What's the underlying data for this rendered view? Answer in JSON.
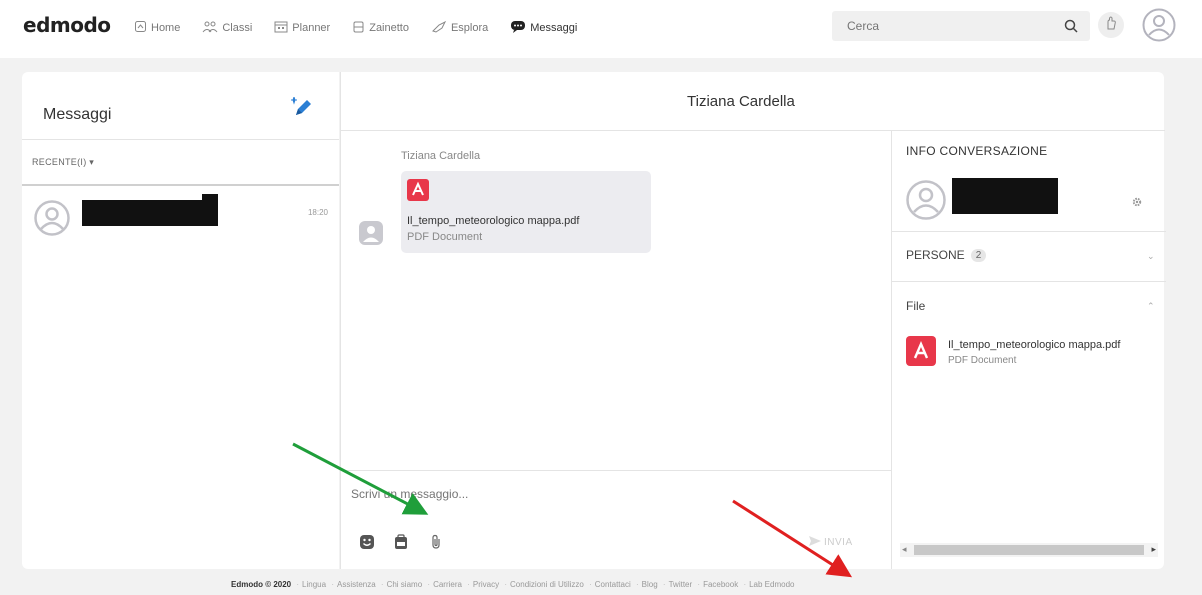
{
  "app": {
    "logo": "edmodo"
  },
  "nav": {
    "items": [
      {
        "label": "Home",
        "icon": "home-icon"
      },
      {
        "label": "Classi",
        "icon": "classes-icon"
      },
      {
        "label": "Planner",
        "icon": "planner-icon"
      },
      {
        "label": "Zainetto",
        "icon": "backpack-icon"
      },
      {
        "label": "Esplora",
        "icon": "explore-icon"
      },
      {
        "label": "Messaggi",
        "icon": "messages-icon",
        "active": true
      }
    ]
  },
  "search": {
    "placeholder": "Cerca"
  },
  "sidebar": {
    "title": "Messaggi",
    "filter": "RECENTE(I) ▾",
    "conversation": {
      "time": "18:20"
    }
  },
  "conversation": {
    "title": "Tiziana Cardella",
    "message": {
      "sender": "Tiziana Cardella",
      "file_name": "Il_tempo_meteorologico mappa.pdf",
      "file_type": "PDF Document"
    },
    "composer": {
      "placeholder": "Scrivi un messaggio...",
      "send_label": "INVIA"
    }
  },
  "info": {
    "title": "INFO CONVERSAZIONE",
    "people_label": "PERSONE",
    "people_count": "2",
    "files_label": "File",
    "file": {
      "name": "Il_tempo_meteorologico mappa.pdf",
      "type": "PDF Document"
    }
  },
  "footer": {
    "copyright": "Edmodo © 2020",
    "links": [
      "Lingua",
      "Assistenza",
      "Chi siamo",
      "Carriera",
      "Privacy",
      "Condizioni di Utilizzo",
      "Contattaci",
      "Blog",
      "Twitter",
      "Facebook",
      "Lab Edmodo"
    ]
  },
  "colors": {
    "accent": "#2b7fd4",
    "pdf_red": "#e8374a",
    "arrow_green": "#1f9e3a",
    "arrow_red": "#e02020"
  }
}
